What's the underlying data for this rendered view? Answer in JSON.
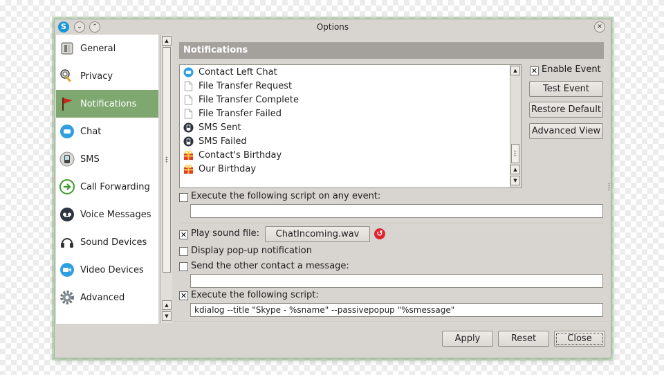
{
  "window": {
    "title": "Options",
    "app_icon": "S"
  },
  "titlebar": {
    "minimize_glyph": "⌄",
    "maximize_glyph": "⌃",
    "close_glyph": "✕"
  },
  "sidebar": {
    "items": [
      {
        "label": "General",
        "icon": "general-icon"
      },
      {
        "label": "Privacy",
        "icon": "privacy-icon"
      },
      {
        "label": "Notifications",
        "icon": "flag-icon",
        "selected": true
      },
      {
        "label": "Chat",
        "icon": "chat-icon"
      },
      {
        "label": "SMS",
        "icon": "sms-icon"
      },
      {
        "label": "Call Forwarding",
        "icon": "call-forwarding-icon"
      },
      {
        "label": "Voice Messages",
        "icon": "voice-messages-icon"
      },
      {
        "label": "Sound Devices",
        "icon": "headset-icon"
      },
      {
        "label": "Video Devices",
        "icon": "video-icon"
      },
      {
        "label": "Advanced",
        "icon": "gear-icon"
      }
    ]
  },
  "notifications": {
    "header": "Notifications",
    "events": [
      {
        "label": "Contact Left Chat",
        "icon": "chat-bubble-icon"
      },
      {
        "label": "File Transfer Request",
        "icon": "file-icon"
      },
      {
        "label": "File Transfer Complete",
        "icon": "file-icon"
      },
      {
        "label": "File Transfer Failed",
        "icon": "file-icon"
      },
      {
        "label": "SMS Sent",
        "icon": "sms-phone-icon"
      },
      {
        "label": "SMS Failed",
        "icon": "sms-phone-icon"
      },
      {
        "label": "Contact's Birthday",
        "icon": "gift-icon"
      },
      {
        "label": "Our Birthday",
        "icon": "gift-icon"
      }
    ],
    "enable_event": {
      "label": "Enable Event",
      "checked": true
    },
    "test_event_label": "Test Event",
    "restore_default_label": "Restore Default",
    "advanced_view_label": "Advanced View",
    "execute_any": {
      "label": "Execute the following script on any event:",
      "checked": false,
      "value": ""
    },
    "play_sound": {
      "label": "Play sound file:",
      "checked": true,
      "file": "ChatIncoming.wav"
    },
    "popup": {
      "label": "Display pop-up notification",
      "checked": false
    },
    "send_message": {
      "label": "Send the other contact a message:",
      "checked": false,
      "value": ""
    },
    "execute_script": {
      "label": "Execute the following script:",
      "checked": true,
      "value": "kdialog --title \"Skype - %sname\" --passivepopup \"%smessage\""
    }
  },
  "footer": {
    "apply": "Apply",
    "reset": "Reset",
    "close": "Close"
  },
  "colors": {
    "selection": "#7ea86f",
    "header": "#a4a19c",
    "window_bg": "#d8d4cf",
    "reset_icon": "#e0242e"
  }
}
